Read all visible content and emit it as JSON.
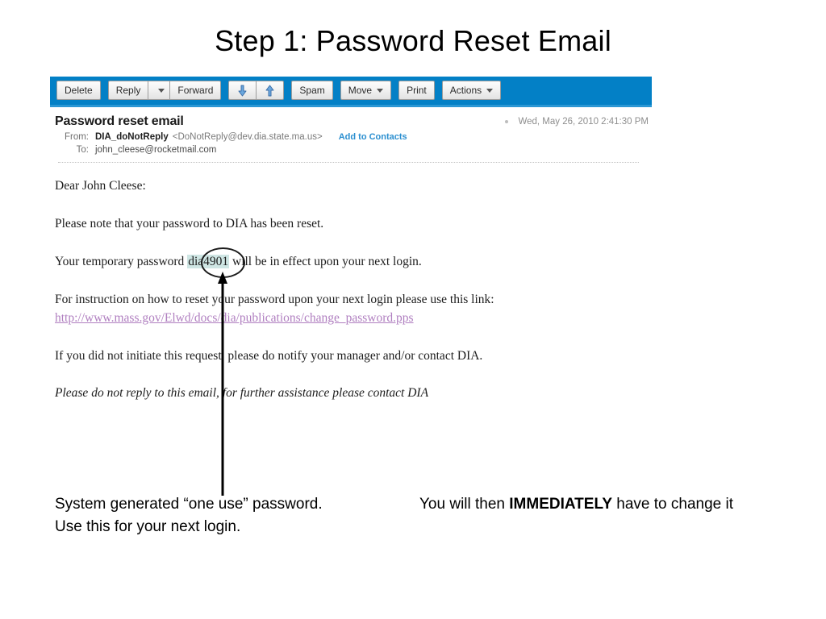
{
  "slide": {
    "title": "Step 1: Password Reset Email"
  },
  "email": {
    "toolbar": {
      "delete_label": "Delete",
      "reply_label": "Reply",
      "reply_caret_icon": "chevron-down-icon",
      "forward_label": "Forward",
      "archive_down_icon": "arrow-down-icon",
      "archive_up_icon": "arrow-up-icon",
      "spam_label": "Spam",
      "move_label": "Move",
      "move_caret_icon": "chevron-down-icon",
      "print_label": "Print",
      "actions_label": "Actions",
      "actions_caret_icon": "chevron-down-icon",
      "background_color": "#0380c6"
    },
    "header": {
      "subject": "Password reset email",
      "date": "Wed, May 26, 2010 2:41:30 PM",
      "from_label": "From:",
      "from_name": "DIA_doNotReply",
      "from_address": "<DoNotReply@dev.dia.state.ma.us>",
      "add_to_contacts_label": "Add to Contacts",
      "to_label": "To:",
      "to_address": "john_cleese@rocketmail.com"
    },
    "body": {
      "greeting": "Dear John Cleese:",
      "line_reset_notice": "Please note that your password to DIA has been reset.",
      "temp_password_prefix": "Your temporary password ",
      "temp_password": "dia4901",
      "temp_password_suffix": " will be in effect upon your next login.",
      "line_instruction": "For instruction on how to reset your password upon your next login please use this link:",
      "link_text": "http://www.mass.gov/Elwd/docs/dia/publications/change_password.pps",
      "link_color": "#b07fc0",
      "line_not_initiated": "If you did not initiate this request, please do notify your manager and/or contact DIA.",
      "line_no_reply": "Please do not reply to this email, for further assistance please contact DIA",
      "highlight_color": "#cfe6e4"
    }
  },
  "annotations": {
    "left": "System generated “one use” password. Use this for your next login.",
    "right_prefix": "You will then ",
    "right_emphasis": "IMMEDIATELY",
    "right_suffix": " have to change it"
  }
}
